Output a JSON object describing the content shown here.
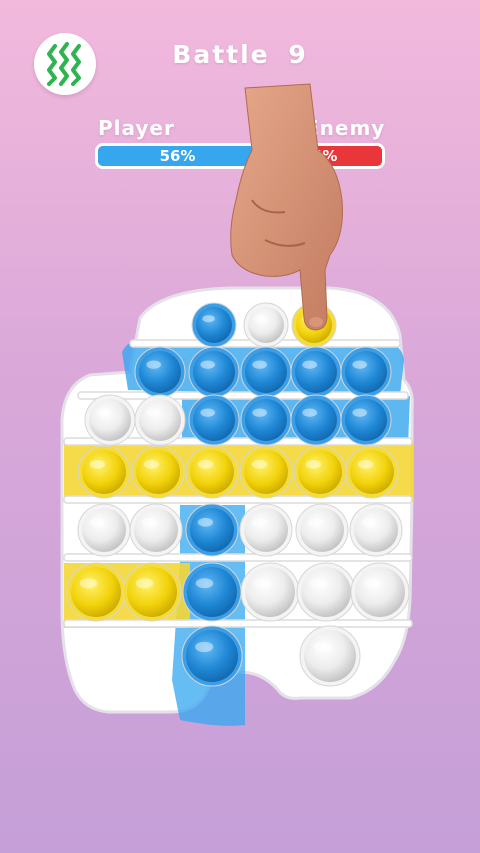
{
  "hud": {
    "title": "Battle  9",
    "player_label": "Player",
    "enemy_label": "Enemy",
    "player_pct_text": "56%",
    "enemy_pct_text": "44%",
    "player_share": 0.56
  },
  "icons": {
    "vibration": "vibration-icon",
    "hand": "pointing-hand"
  },
  "colors": {
    "player": "#36a7ef",
    "enemy": "#e8363b",
    "blue_bubble": "#1e86d4",
    "yellow_bubble": "#f2d20a",
    "white_bubble": "#e9e9e9",
    "board": "#ffffff",
    "vibration_icon": "#2fb34e"
  },
  "board": {
    "rows": [
      [
        "blue",
        "white",
        "yellow"
      ],
      [
        "blue",
        "blue",
        "blue",
        "blue",
        "blue"
      ],
      [
        "white",
        "white",
        "blue",
        "blue",
        "blue",
        "blue"
      ],
      [
        "yellow",
        "yellow",
        "yellow",
        "yellow",
        "yellow",
        "yellow"
      ],
      [
        "white",
        "white",
        "blue",
        "white",
        "white",
        "white"
      ],
      [
        "yellow",
        "yellow",
        "blue",
        "white",
        "white",
        "white"
      ],
      [
        "blue",
        "white"
      ]
    ]
  }
}
